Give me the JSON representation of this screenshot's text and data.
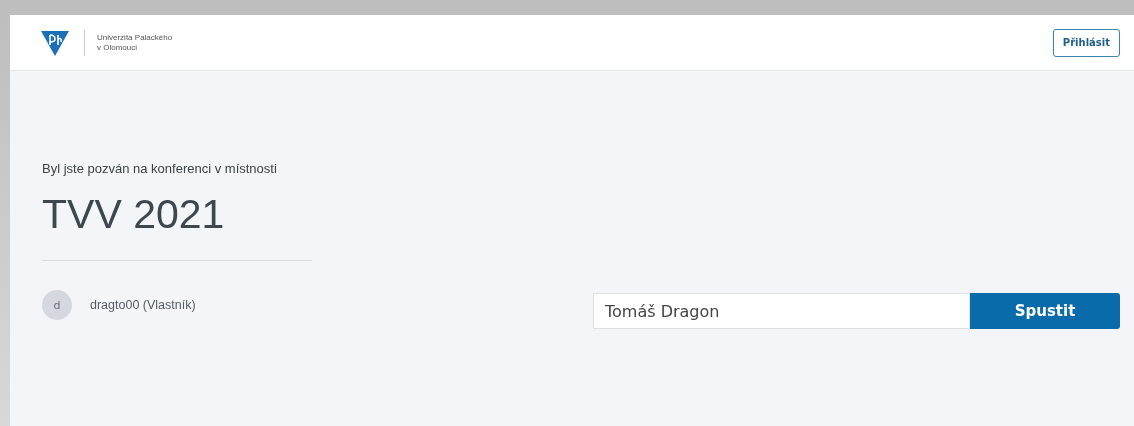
{
  "header": {
    "university_name": [
      "Univerzita Palackého",
      "v Olomouci"
    ],
    "login_button": "Přihlásit"
  },
  "invitation": {
    "lead": "Byl jste pozván na konferenci v místnosti",
    "room": "TVV 2021"
  },
  "owner": {
    "initial": "d",
    "name": "dragto00 (Vlastník)"
  },
  "join_form": {
    "name_value": "Tomáš Dragon",
    "start_button": "Spustit"
  }
}
